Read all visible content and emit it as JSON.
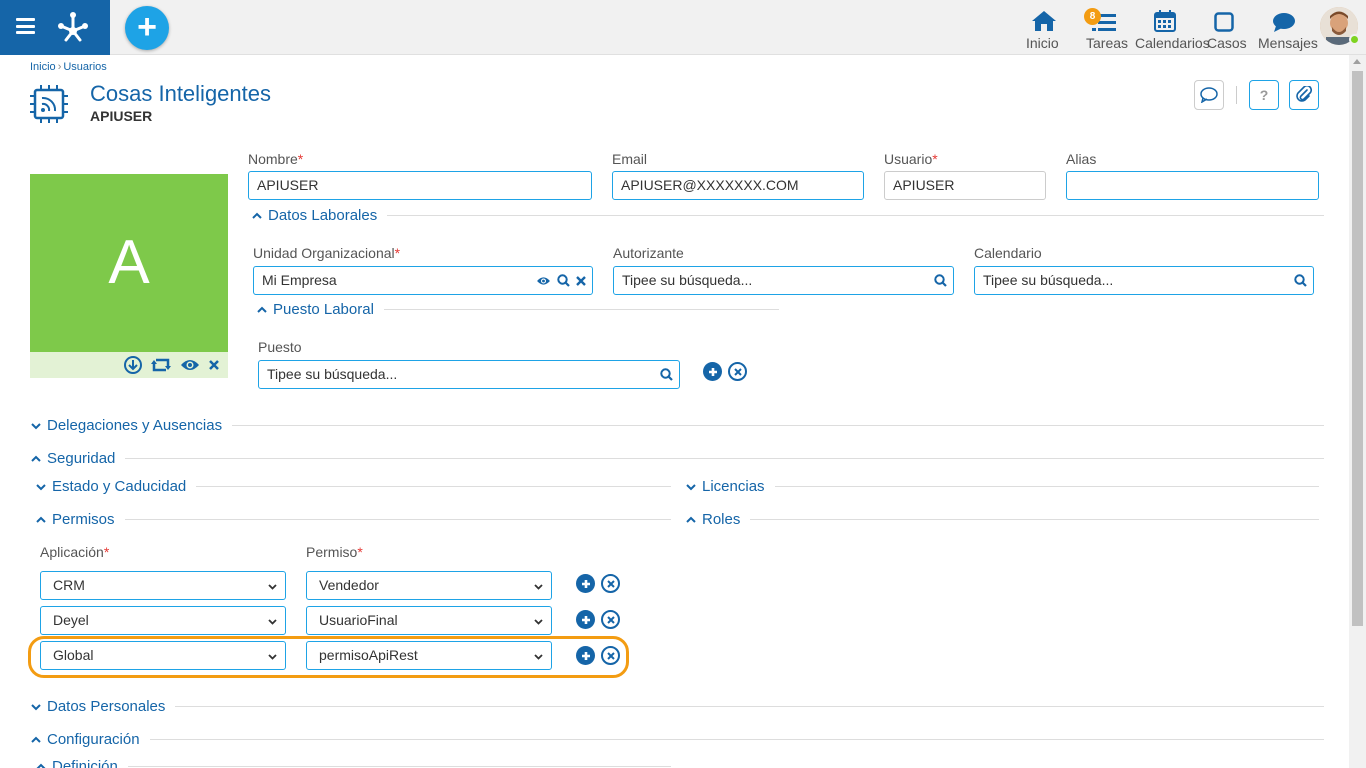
{
  "topnav": {
    "items": [
      {
        "label": "Inicio"
      },
      {
        "label": "Tareas",
        "badge": "8"
      },
      {
        "label": "Calendarios"
      },
      {
        "label": "Casos"
      },
      {
        "label": "Mensajes"
      }
    ]
  },
  "breadcrumb": {
    "home": "Inicio",
    "sep": "›",
    "current": "Usuarios"
  },
  "header": {
    "title": "Cosas Inteligentes",
    "subtitle": "APIUSER",
    "help_label": "?"
  },
  "photo": {
    "initial": "A"
  },
  "fields": {
    "nombre": {
      "label": "Nombre",
      "value": "APIUSER"
    },
    "email": {
      "label": "Email",
      "value": "APIUSER@XXXXXXX.COM"
    },
    "usuario": {
      "label": "Usuario",
      "value": "APIUSER"
    },
    "alias": {
      "label": "Alias",
      "value": ""
    }
  },
  "required_mark": "*",
  "datos_laborales": {
    "title": "Datos Laborales",
    "unidad": {
      "label": "Unidad Organizacional",
      "value": "Mi Empresa"
    },
    "autorizante": {
      "label": "Autorizante",
      "placeholder": "Tipee su búsqueda..."
    },
    "calendario": {
      "label": "Calendario",
      "placeholder": "Tipee su búsqueda..."
    },
    "puesto_laboral": {
      "title": "Puesto Laboral",
      "label": "Puesto",
      "placeholder": "Tipee su búsqueda..."
    }
  },
  "sections": {
    "delegaciones": "Delegaciones y Ausencias",
    "seguridad": "Seguridad",
    "estado": "Estado y Caducidad",
    "licencias": "Licencias",
    "permisos": "Permisos",
    "roles": "Roles",
    "datos_personales": "Datos Personales",
    "configuracion": "Configuración",
    "definicion": "Definición"
  },
  "permisos": {
    "col_aplicacion": "Aplicación",
    "col_permiso": "Permiso",
    "rows": [
      {
        "aplicacion": "CRM",
        "permiso": "Vendedor"
      },
      {
        "aplicacion": "Deyel",
        "permiso": "UsuarioFinal"
      },
      {
        "aplicacion": "Global",
        "permiso": "permisoApiRest"
      }
    ]
  },
  "colors": {
    "primary": "#1565a8",
    "accent": "#1ea3e6",
    "photo_bg": "#7ec94a",
    "highlight": "#f39c12"
  }
}
